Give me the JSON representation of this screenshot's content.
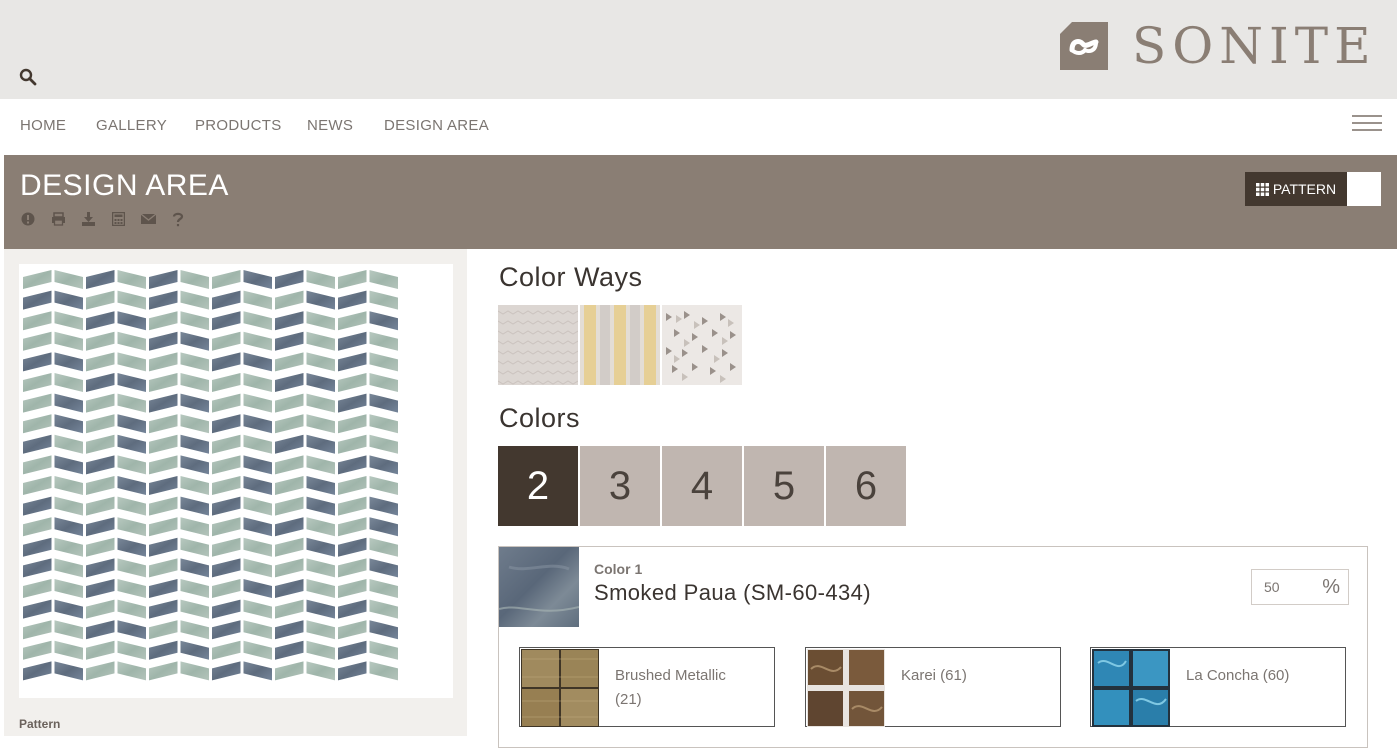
{
  "brand": {
    "name": "SONITE"
  },
  "header": {
    "search_icon": "search-icon"
  },
  "nav": {
    "items": [
      {
        "label": "HOME"
      },
      {
        "label": "GALLERY"
      },
      {
        "label": "PRODUCTS"
      },
      {
        "label": "NEWS"
      },
      {
        "label": "DESIGN AREA"
      }
    ],
    "menu_icon": "hamburger-icon"
  },
  "banner": {
    "title": "DESIGN AREA",
    "tools": [
      "info-icon",
      "print-icon",
      "download-icon",
      "calculator-icon",
      "email-icon",
      "help-icon"
    ],
    "pattern_button": "PATTERN"
  },
  "left": {
    "pattern_label": "Pattern"
  },
  "colorways": {
    "title": "Color Ways"
  },
  "colors": {
    "title": "Colors",
    "counts": [
      "2",
      "3",
      "4",
      "5",
      "6"
    ],
    "selected": "2"
  },
  "color1": {
    "label": "Color 1",
    "name": "Smoked Paua (SM-60-434)",
    "percent": "50",
    "percent_sign": "%"
  },
  "materials": [
    {
      "label": "Brushed Metallic (21)"
    },
    {
      "label": "Karei (61)"
    },
    {
      "label": "La Concha (60)"
    }
  ],
  "colors_hex": {
    "topbar": "#e8e7e5",
    "banner": "#8a7e74",
    "dark": "#43382f",
    "count_inactive": "#c0b6b0",
    "tile_blue": "#6e7d8e",
    "tile_green": "#a9bdb2"
  }
}
